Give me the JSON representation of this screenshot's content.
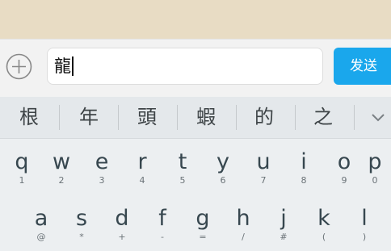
{
  "composer": {
    "input_value": "龍",
    "send_label": "发送"
  },
  "candidates": [
    "根",
    "年",
    "頭",
    "蝦",
    "的",
    "之"
  ],
  "keyboard": {
    "row1": [
      {
        "main": "q",
        "sub": "1"
      },
      {
        "main": "w",
        "sub": "2"
      },
      {
        "main": "e",
        "sub": "3"
      },
      {
        "main": "r",
        "sub": "4"
      },
      {
        "main": "t",
        "sub": "5"
      },
      {
        "main": "y",
        "sub": "6"
      },
      {
        "main": "u",
        "sub": "7"
      },
      {
        "main": "i",
        "sub": "8"
      },
      {
        "main": "o",
        "sub": "9"
      },
      {
        "main": "p",
        "sub": "0"
      }
    ],
    "row2": [
      {
        "main": "a",
        "sub": "@"
      },
      {
        "main": "s",
        "sub": "*"
      },
      {
        "main": "d",
        "sub": "+"
      },
      {
        "main": "f",
        "sub": "-"
      },
      {
        "main": "g",
        "sub": "="
      },
      {
        "main": "h",
        "sub": "/"
      },
      {
        "main": "j",
        "sub": "#"
      },
      {
        "main": "k",
        "sub": "("
      },
      {
        "main": "l",
        "sub": ")"
      }
    ]
  },
  "icons": {
    "plus": "add-circle-icon",
    "expand": "chevron-down-icon"
  },
  "colors": {
    "send_button": "#1aa7ec",
    "top_strip": "#e8dcc4",
    "keyboard_bg": "#eceff1"
  }
}
